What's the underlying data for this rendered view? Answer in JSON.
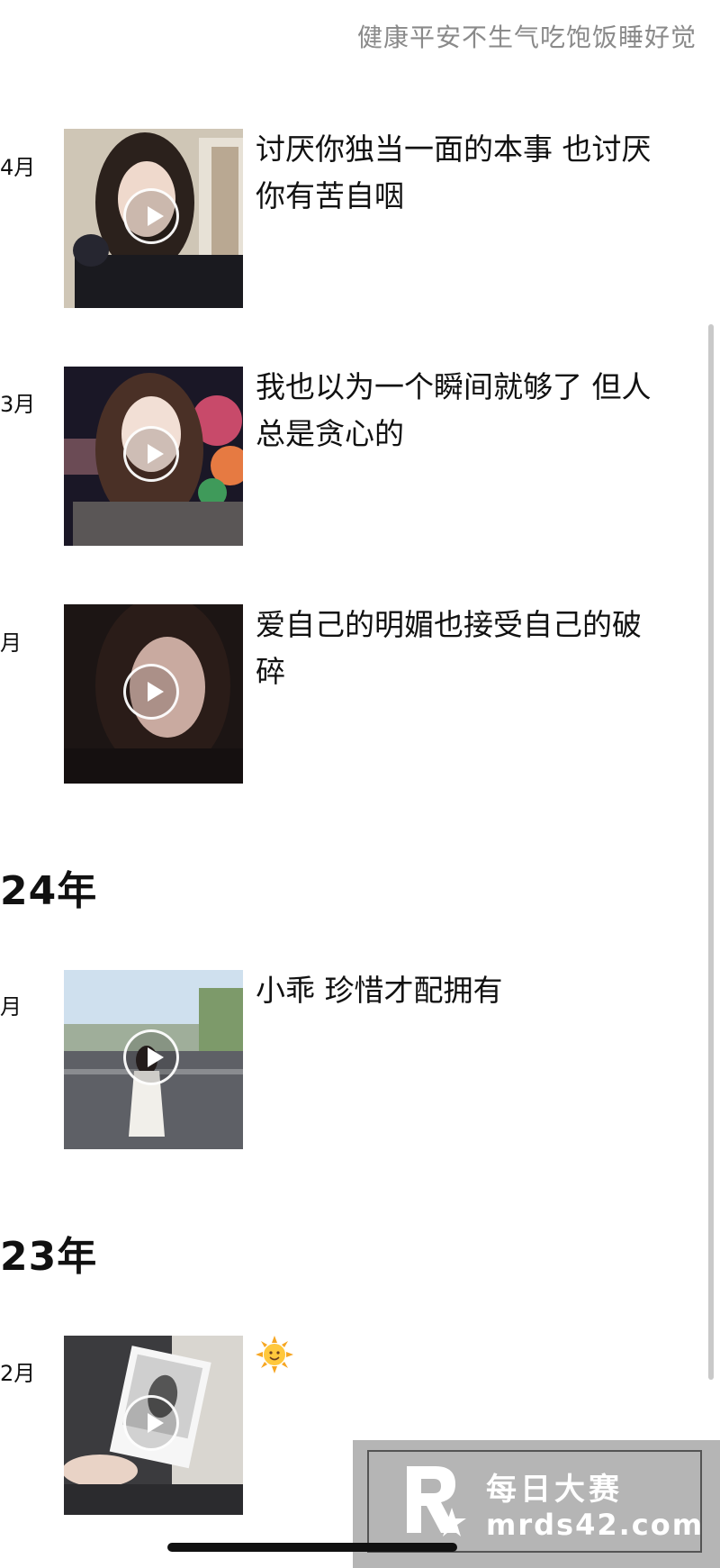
{
  "profile": {
    "signature": "健康平安不生气吃饱饭睡好觉"
  },
  "timeline": [
    {
      "month": "4月",
      "caption": "讨厌你独当一面的本事 也讨厌你有苦自咽"
    },
    {
      "month": "3月",
      "caption": "我也以为一个瞬间就够了 但人总是贪心的"
    },
    {
      "month": "月",
      "caption": "爱自己的明媚也接受自己的破碎"
    },
    {
      "year": "24年"
    },
    {
      "month": "月",
      "caption": "小乖 珍惜才配拥有"
    },
    {
      "year": "23年"
    },
    {
      "month": "2月",
      "caption": "",
      "emoji": "sun-face-emoji"
    }
  ],
  "watermark": {
    "title": "每日大赛",
    "site": "mrds42.com"
  }
}
